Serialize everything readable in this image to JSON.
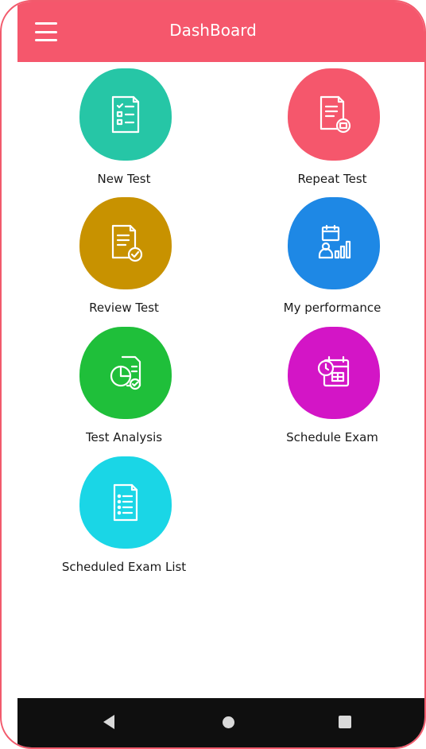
{
  "app_bar": {
    "title": "DashBoard",
    "menu_icon": "hamburger-menu-icon",
    "color": "#f5576c"
  },
  "tiles": [
    {
      "label": "New Test",
      "color": "#26c6a6",
      "icon": "checklist-document-icon"
    },
    {
      "label": "Repeat Test",
      "color": "#f5576c",
      "icon": "document-repeat-icon"
    },
    {
      "label": "Review Test",
      "color": "#c89200",
      "icon": "document-check-icon"
    },
    {
      "label": "My performance",
      "color": "#1e88e5",
      "icon": "performance-chart-icon"
    },
    {
      "label": "Test Analysis",
      "color": "#1fbf3a",
      "icon": "pie-chart-document-icon"
    },
    {
      "label": "Schedule Exam",
      "color": "#d315c6",
      "icon": "calendar-clock-icon"
    },
    {
      "label": "Scheduled Exam List",
      "color": "#1ad6e6",
      "icon": "list-document-icon"
    }
  ],
  "nav_bar": {
    "back_icon": "back-triangle-icon",
    "home_icon": "home-circle-icon",
    "recent_icon": "recent-apps-square-icon"
  }
}
